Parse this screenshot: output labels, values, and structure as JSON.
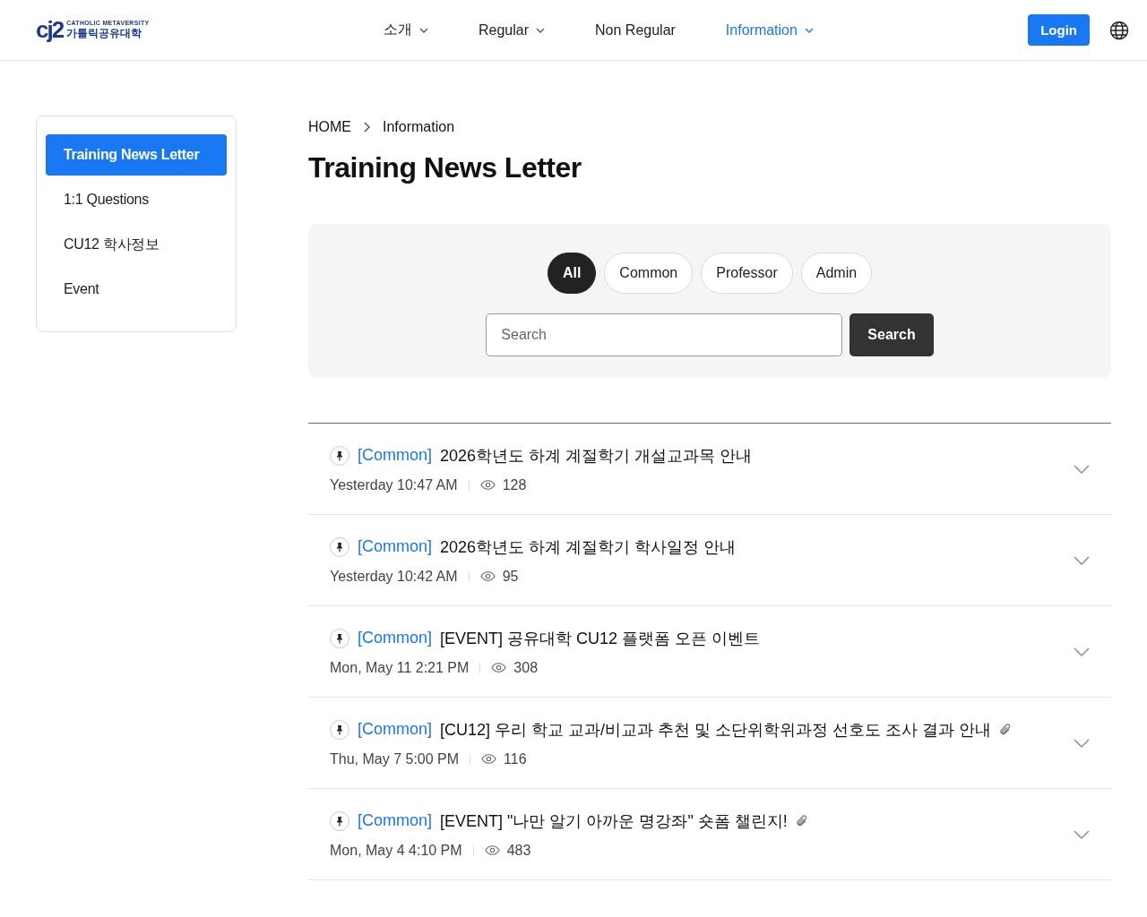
{
  "logo": {
    "mark": "cj2",
    "tagline": "CATHOLIC METAVERSITY",
    "name": "가톨릭공유대학"
  },
  "nav": [
    {
      "label": "소개",
      "dropdown": true,
      "selected": false
    },
    {
      "label": "Regular",
      "dropdown": true,
      "selected": false
    },
    {
      "label": "Non Regular",
      "dropdown": false,
      "selected": false
    },
    {
      "label": "Information",
      "dropdown": true,
      "selected": true
    }
  ],
  "login": "Login",
  "sidebar": {
    "items": [
      {
        "label": "Training News Letter",
        "selected": true
      },
      {
        "label": "1:1 Questions",
        "selected": false
      },
      {
        "label": "CU12 학사정보",
        "selected": false
      },
      {
        "label": "Event",
        "selected": false
      }
    ]
  },
  "breadcrumb": [
    "HOME",
    "Information"
  ],
  "title": "Training News Letter",
  "filters": [
    {
      "label": "All",
      "selected": true
    },
    {
      "label": "Common",
      "selected": false
    },
    {
      "label": "Professor",
      "selected": false
    },
    {
      "label": "Admin",
      "selected": false
    }
  ],
  "search": {
    "placeholder": "Search",
    "button": "Search"
  },
  "posts": [
    {
      "pinned": true,
      "category": "[Common]",
      "title": "2026학년도 하계 계절학기 개설교과목 안내",
      "attachment": false,
      "date": "Yesterday 10:47 AM",
      "views": "128"
    },
    {
      "pinned": true,
      "category": "[Common]",
      "title": "2026학년도 하계 계절학기 학사일정 안내",
      "attachment": false,
      "date": "Yesterday 10:42 AM",
      "views": "95"
    },
    {
      "pinned": true,
      "category": "[Common]",
      "title": "[EVENT] 공유대학 CU12 플랫폼 오픈 이벤트",
      "attachment": false,
      "date": "Mon, May 11 2:21 PM",
      "views": "308"
    },
    {
      "pinned": true,
      "category": "[Common]",
      "title": "[CU12] 우리 학교 교과/비교과 추천 및 소단위학위과정 선호도 조사 결과 안내",
      "attachment": true,
      "date": "Thu, May 7 5:00 PM",
      "views": "116"
    },
    {
      "pinned": true,
      "category": "[Common]",
      "title": "[EVENT] \"나만 알기 아까운 명강좌\" 숏폼 챌린지!",
      "attachment": true,
      "date": "Mon, May 4 4:10 PM",
      "views": "483"
    }
  ]
}
